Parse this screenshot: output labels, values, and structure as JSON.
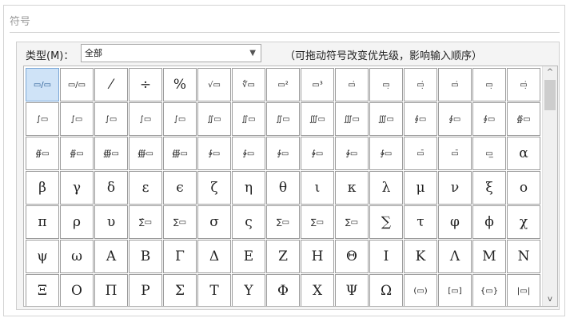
{
  "window": {
    "title": "符号"
  },
  "type_row": {
    "label": "类型(M)：",
    "selected": "全部",
    "hint": "（可拖动符号改变优先级，影响输入顺序）"
  },
  "symbols": [
    [
      "▭/▭",
      "▭/▭",
      "⁄",
      "÷",
      "%",
      "√▭",
      "∜▭",
      "▭²",
      "▭³",
      "▭̇",
      "▭̣",
      "▭̣̇",
      "▭̇",
      "▭̣",
      "▭̣̇"
    ],
    [
      "∫▭",
      "∫▭",
      "∫▭",
      "∫▭",
      "∫▭",
      "∬▭",
      "∬▭",
      "∬▭",
      "∭▭",
      "∭▭",
      "∭▭",
      "∮▭",
      "∮▭",
      "∮▭",
      "∯▭"
    ],
    [
      "∯▭",
      "∯▭",
      "∰▭",
      "∰▭",
      "∰▭",
      "∲▭",
      "∲▭",
      "∲▭",
      "∳▭",
      "∳▭",
      "∳▭",
      "▭̄",
      "▭̄",
      "▭̲",
      "α"
    ],
    [
      "β",
      "γ",
      "δ",
      "ε",
      "ϵ",
      "ζ",
      "η",
      "θ",
      "ι",
      "κ",
      "λ",
      "μ",
      "ν",
      "ξ",
      "ο"
    ],
    [
      "π",
      "ρ",
      "υ",
      "∑̂▭",
      "∑▭",
      "σ",
      "ς",
      "∑▭",
      "∑▭",
      "∑▭",
      "∑",
      "τ",
      "φ",
      "ϕ",
      "χ"
    ],
    [
      "ψ",
      "ω",
      "Α",
      "Β",
      "Γ",
      "Δ",
      "Ε",
      "Ζ",
      "Η",
      "Θ",
      "Ι",
      "Κ",
      "Λ",
      "Μ",
      "Ν"
    ],
    [
      "Ξ",
      "Ο",
      "Π",
      "Ρ",
      "Σ",
      "Τ",
      "Υ",
      "Φ",
      "Χ",
      "Ψ",
      "Ω",
      "(▭)",
      "[▭]",
      "{▭}",
      "|▭|"
    ]
  ],
  "scroll": {
    "up": "^",
    "down": "v"
  }
}
